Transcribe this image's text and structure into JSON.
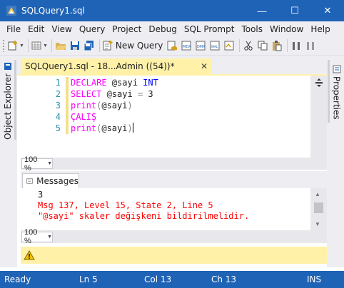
{
  "window": {
    "title": "SQLQuery1.sql",
    "min_glyph": "—",
    "max_glyph": "☐",
    "close_glyph": "✕"
  },
  "menu": [
    "File",
    "Edit",
    "View",
    "Query",
    "Project",
    "Debug",
    "SQL Prompt",
    "Tools",
    "Window",
    "Help"
  ],
  "toolbar": {
    "new_query_label": "New Query"
  },
  "side_panels": {
    "left_label": "Object Explorer",
    "right_label": "Properties"
  },
  "document_tab": {
    "label": "SQLQuery1.sql - 18...Admin ((54))*",
    "close_glyph": "✕"
  },
  "editor": {
    "line_numbers": [
      "1",
      "2",
      "3",
      "4",
      "5"
    ],
    "lines": [
      [
        {
          "t": "DECLARE",
          "c": "fn"
        },
        {
          "t": " @sayi ",
          "c": "var"
        },
        {
          "t": "INT",
          "c": "kw"
        }
      ],
      [
        {
          "t": "SELECT",
          "c": "fn"
        },
        {
          "t": " @sayi ",
          "c": "var"
        },
        {
          "t": "=",
          "c": "op"
        },
        {
          "t": " 3",
          "c": "num"
        }
      ],
      [
        {
          "t": "print",
          "c": "fn"
        },
        {
          "t": "(",
          "c": "op"
        },
        {
          "t": "@sayi",
          "c": "var"
        },
        {
          "t": ")",
          "c": "op"
        }
      ],
      [
        {
          "t": "ÇALIŞ",
          "c": "fn"
        }
      ],
      [
        {
          "t": "print",
          "c": "fn"
        },
        {
          "t": "(",
          "c": "op"
        },
        {
          "t": "@sayi",
          "c": "var"
        },
        {
          "t": ")",
          "c": "op"
        }
      ]
    ],
    "zoom": "100 %"
  },
  "results": {
    "tab_label": "Messages",
    "lines": [
      {
        "text": "3",
        "kind": "normal"
      },
      {
        "text": "Msg 137, Level 15, State 2, Line 5",
        "kind": "error"
      },
      {
        "text": "\"@sayi\" skaler değişkeni bildirilmelidir.",
        "kind": "error"
      }
    ],
    "zoom": "100 %"
  },
  "statusbar": {
    "ready": "Ready",
    "line": "Ln 5",
    "col": "Col 13",
    "ch": "Ch 13",
    "mode": "INS"
  },
  "colors": {
    "accent": "#1f63b6",
    "tab_yellow": "#fff1a8",
    "keyword": "#0000ff",
    "function": "#ff00ff",
    "error": "#ff0000",
    "line_number": "#2b91af"
  }
}
